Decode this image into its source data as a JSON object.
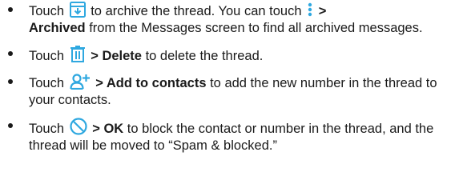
{
  "icons": {
    "color": "#2fa8e0",
    "archive": "archive-icon",
    "more": "more-vertical-icon",
    "delete": "trash-icon",
    "add_contact": "add-person-icon",
    "block": "block-icon"
  },
  "items": [
    {
      "t1": "Touch",
      "t2": "to archive the thread. You can touch",
      "t3": ">",
      "t4": "Archived",
      "t5": "from the Messages screen to find all archived messages."
    },
    {
      "t1": "Touch",
      "t2": "> Delete",
      "t3": "to delete the thread."
    },
    {
      "t1": "Touch",
      "t2": "> Add to contacts",
      "t3": "to add the new number in the thread to your contacts."
    },
    {
      "t1": "Touch",
      "t2": "> OK",
      "t3": "to block the contact or number in the thread, and the thread will be moved to “Spam & blocked.”"
    }
  ]
}
